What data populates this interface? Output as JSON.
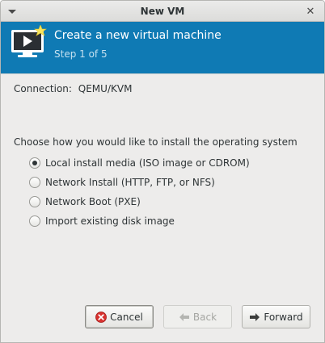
{
  "window": {
    "title": "New VM"
  },
  "banner": {
    "title": "Create a new virtual machine",
    "subtitle": "Step 1 of 5",
    "color": "#0f7ab4"
  },
  "connection": {
    "label": "Connection:",
    "value": "QEMU/KVM"
  },
  "install": {
    "prompt": "Choose how you would like to install the operating system",
    "options": [
      {
        "label": "Local install media (ISO image or CDROM)",
        "checked": true
      },
      {
        "label": "Network Install (HTTP, FTP, or NFS)",
        "checked": false
      },
      {
        "label": "Network Boot (PXE)",
        "checked": false
      },
      {
        "label": "Import existing disk image",
        "checked": false
      }
    ]
  },
  "buttons": {
    "cancel": "Cancel",
    "back": "Back",
    "forward": "Forward"
  },
  "icons": {
    "window_menu": "chevron-down-icon",
    "close": "close-icon",
    "banner": "new-vm-monitor-icon",
    "cancel": "cancel-icon",
    "back": "back-arrow-icon",
    "forward": "forward-arrow-icon"
  }
}
